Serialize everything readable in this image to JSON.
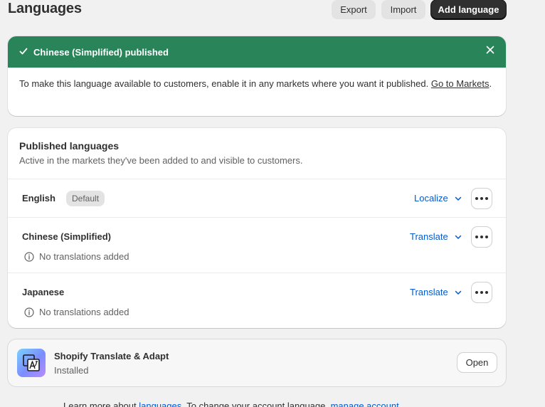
{
  "header": {
    "title": "Languages",
    "export_label": "Export",
    "import_label": "Import",
    "add_label": "Add language"
  },
  "banner": {
    "title": "Chinese (Simplified) published",
    "body": "To make this language available to customers, enable it in any markets where you want it published.",
    "link_label": "Go to Markets",
    "trail": ".",
    "status_color": "#29845a"
  },
  "published": {
    "title": "Published languages",
    "subtitle": "Active in the markets they've been added to and visible to customers.",
    "languages": [
      {
        "name": "English",
        "badge": "Default",
        "action": "Localize",
        "status": ""
      },
      {
        "name": "Chinese (Simplified)",
        "badge": "",
        "action": "Translate",
        "status": "No translations added"
      },
      {
        "name": "Japanese",
        "badge": "",
        "action": "Translate",
        "status": "No translations added"
      }
    ]
  },
  "app": {
    "name": "Shopify Translate & Adapt",
    "status": "Installed",
    "open_label": "Open"
  },
  "footer": {
    "prefix": "Learn more about ",
    "link1": "languages",
    "middle": ". To change your account language, ",
    "link2": "manage account"
  },
  "colors": {
    "accent_link": "#005bd3",
    "primary_button": "#303030",
    "success_banner": "#29845a"
  }
}
